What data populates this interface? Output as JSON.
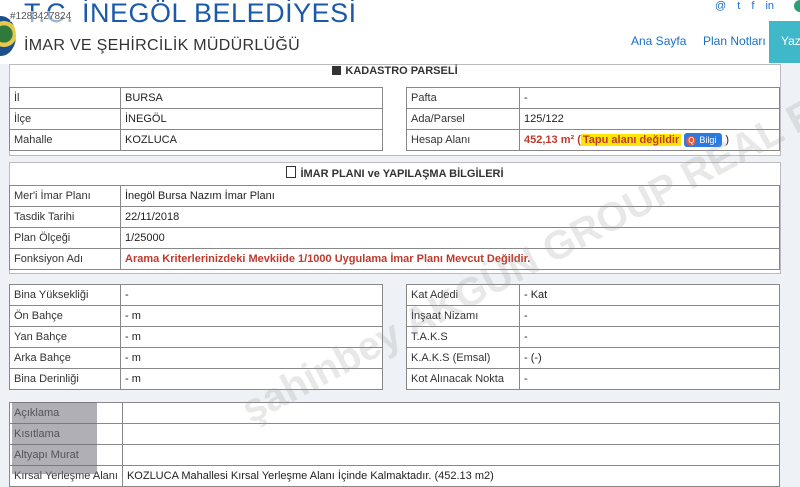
{
  "header": {
    "photo_id": "#1283427824",
    "title": "T.C. İNEGÖL BELEDİYESİ",
    "subtitle": "İMAR VE ŞEHİRCİLİK MÜDÜRLÜĞÜ",
    "social": [
      "@",
      "t",
      "f",
      "in"
    ],
    "nav": [
      "Ana Sayfa",
      "Plan Notları",
      "Yazı"
    ]
  },
  "kadastro": {
    "title": "KADASTRO PARSELİ",
    "left": [
      {
        "label": "İl",
        "value": "BURSA"
      },
      {
        "label": "İlçe",
        "value": "İNEGÖL"
      },
      {
        "label": "Mahalle",
        "value": "KOZLUCA"
      }
    ],
    "right": [
      {
        "label": "Pafta",
        "value": "-"
      },
      {
        "label": "Ada/Parsel",
        "value": "125/122"
      },
      {
        "label": "Hesap Alanı",
        "value": "452,13 m²",
        "note_open": "(",
        "note": "Tapu alanı değildir",
        "button": "Bilgi",
        "note_close": ")"
      }
    ]
  },
  "imar": {
    "title": "İMAR PLANI ve YAPILAŞMA BİLGİLERİ",
    "rows": [
      {
        "label": "Mer'i İmar Planı",
        "value": "İnegöl Bursa Nazım İmar Planı"
      },
      {
        "label": "Tasdik Tarihi",
        "value": "22/11/2018"
      },
      {
        "label": "Plan Ölçeği",
        "value": "1/25000"
      },
      {
        "label": "Fonksiyon Adı",
        "value": "Arama Kriterlerinizdeki Mevkiide 1/1000 Uygulama İmar Planı Mevcut Değildir."
      }
    ]
  },
  "yapi": {
    "left": [
      {
        "label": "Bina Yüksekliği",
        "value": "-"
      },
      {
        "label": "Ön Bahçe",
        "value": "- m"
      },
      {
        "label": "Yan Bahçe",
        "value": "- m"
      },
      {
        "label": "Arka Bahçe",
        "value": "- m"
      },
      {
        "label": "Bina Derinliği",
        "value": "- m"
      }
    ],
    "right": [
      {
        "label": "Kat Adedi",
        "value": "- Kat"
      },
      {
        "label": "İnşaat Nizamı",
        "value": "-"
      },
      {
        "label": "T.A.K.S",
        "value": "-"
      },
      {
        "label": "K.A.K.S (Emsal)",
        "value": "- (-)"
      },
      {
        "label": "Kot Alınacak Nokta",
        "value": "-"
      }
    ]
  },
  "notes": [
    {
      "label": "Açıklama",
      "value": ""
    },
    {
      "label": "Kısıtlama",
      "value": ""
    },
    {
      "label": "Altyapı Murat",
      "value": ""
    },
    {
      "label": "Kırsal Yerleşme Alanı",
      "value": "KOZLUCA Mahallesi Kırsal Yerleşme Alanı İçinde Kalmaktadır. (452.13 m2)"
    }
  ],
  "watermark": "şahinbey AKGÜN GROUP REAL ESTATE",
  "colors": {
    "title_blue": "#1a5aa8",
    "nav_blue": "#1a6fc4",
    "active_tab": "#3fb8c9",
    "warning_red": "#c0392b",
    "highlight_yellow": "#ffe600"
  }
}
